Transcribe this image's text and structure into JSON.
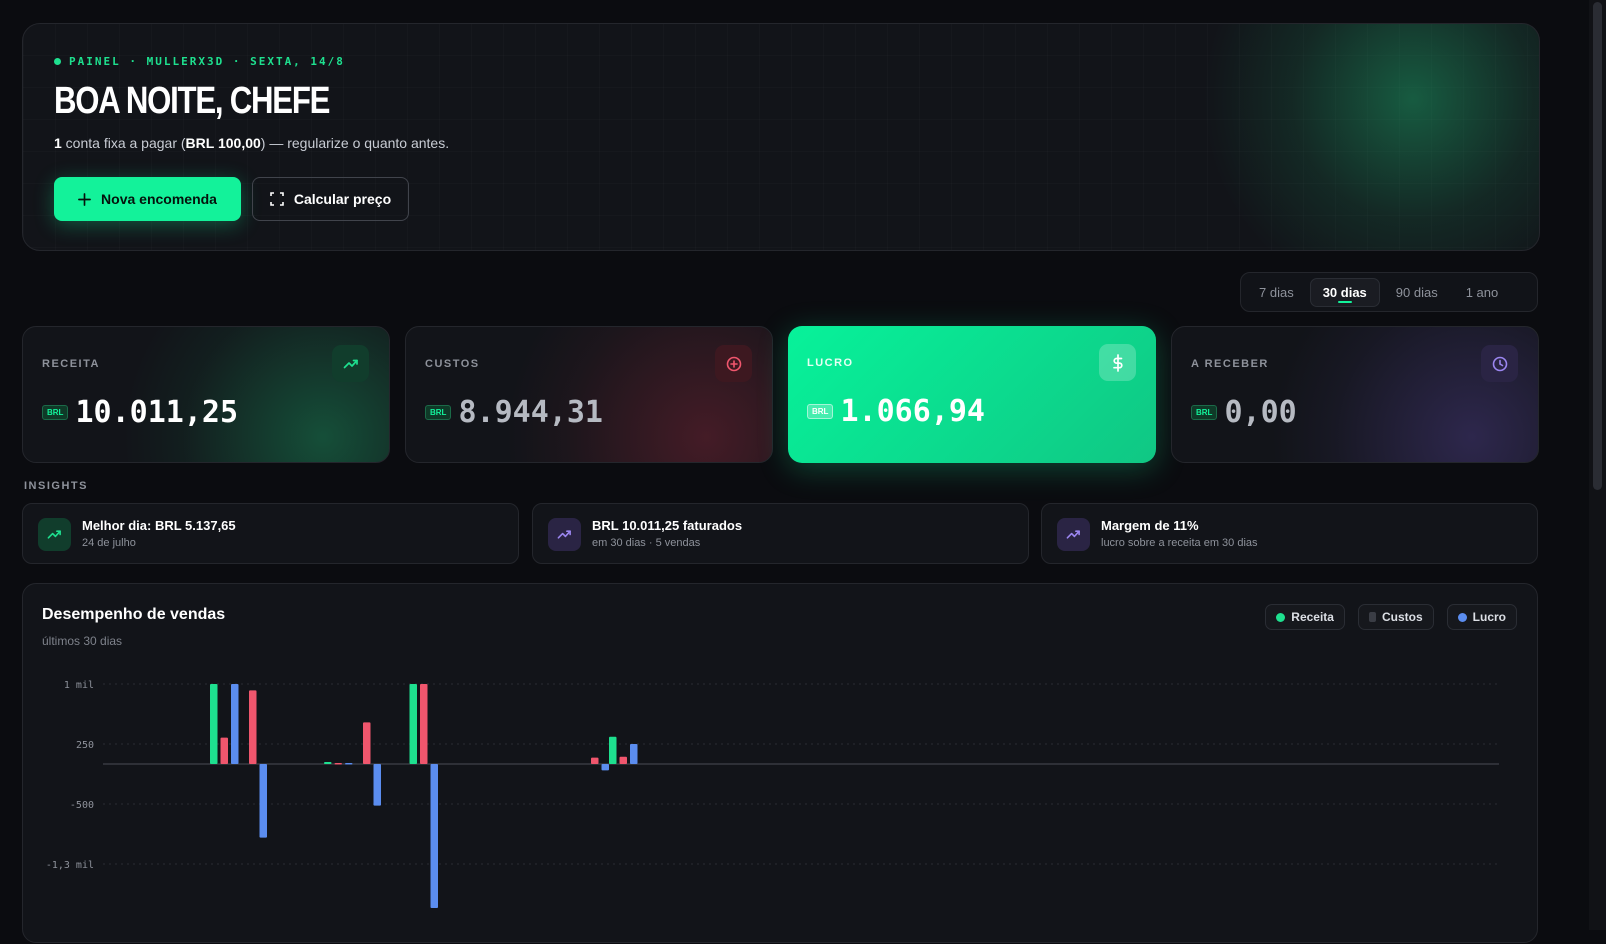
{
  "hero": {
    "eyebrow": "PAINEL · MULLERX3D · SEXTA, 14/8",
    "title": "BOA NOITE, CHEFE",
    "sub_count": "1",
    "sub_text_a": " conta fixa a pagar (",
    "sub_amount": "BRL 100,00",
    "sub_text_b": ") — regularize o quanto antes.",
    "primary_button": "Nova encomenda",
    "secondary_button": "Calcular preço"
  },
  "range": {
    "tabs": [
      "7 dias",
      "30 dias",
      "90 dias",
      "1 ano"
    ],
    "active": "30 dias"
  },
  "kpis": [
    {
      "label": "RECEITA",
      "currency": "BRL",
      "value": "10.011,25",
      "icon": "trending-up-icon"
    },
    {
      "label": "CUSTOS",
      "currency": "BRL",
      "value": "8.944,31",
      "icon": "plus-circle-icon"
    },
    {
      "label": "LUCRO",
      "currency": "BRL",
      "value": "1.066,94",
      "icon": "dollar-icon"
    },
    {
      "label": "A RECEBER",
      "currency": "BRL",
      "value": "0,00",
      "icon": "clock-icon"
    }
  ],
  "insights_label": "INSIGHTS",
  "insights": [
    {
      "title": "Melhor dia: BRL 5.137,65",
      "sub": "24 de julho"
    },
    {
      "title": "BRL 10.011,25 faturados",
      "sub": "em 30 dias · 5 vendas"
    },
    {
      "title": "Margem de 11%",
      "sub": "lucro sobre a receita em 30 dias"
    }
  ],
  "colors": {
    "accent": "#13f29a",
    "receita": "#1ee08f",
    "custos": "#f0566d",
    "lucro": "#5b8def",
    "background": "#0b0c10"
  },
  "chart": {
    "title": "Desempenho de vendas",
    "subtitle": "últimos 30 dias",
    "legend": [
      "Receita",
      "Custos",
      "Lucro"
    ]
  },
  "chart_data": {
    "type": "bar",
    "title": "Desempenho de vendas",
    "subtitle": "últimos 30 dias",
    "y_ticks": [
      {
        "value": 1000,
        "label": "1 mil"
      },
      {
        "value": 250,
        "label": "250"
      },
      {
        "value": -500,
        "label": "-500"
      },
      {
        "value": -1250,
        "label": "-1,3 mil"
      }
    ],
    "ylim": [
      -1800,
      1000
    ],
    "x_slots": 30,
    "grid": "horizontal-dotted",
    "legend_position": "top-right",
    "series_order": [
      "Receita",
      "Custos",
      "Lucro"
    ],
    "groups": [
      {
        "slot": 3,
        "receita": 1000,
        "custos": 330,
        "lucro": 1000
      },
      {
        "slot": 4,
        "receita": 0,
        "custos": 920,
        "lucro": -920
      },
      {
        "slot": 7,
        "receita": 25,
        "custos": 12,
        "lucro": 13
      },
      {
        "slot": 8,
        "receita": 0,
        "custos": 520,
        "lucro": -520
      },
      {
        "slot": 10,
        "receita": 1000,
        "custos": 1000,
        "lucro": -1800
      },
      {
        "slot": 16,
        "receita": 0,
        "custos": 80,
        "lucro": -80
      },
      {
        "slot": 17,
        "receita": 340,
        "custos": 90,
        "lucro": 250
      }
    ]
  }
}
